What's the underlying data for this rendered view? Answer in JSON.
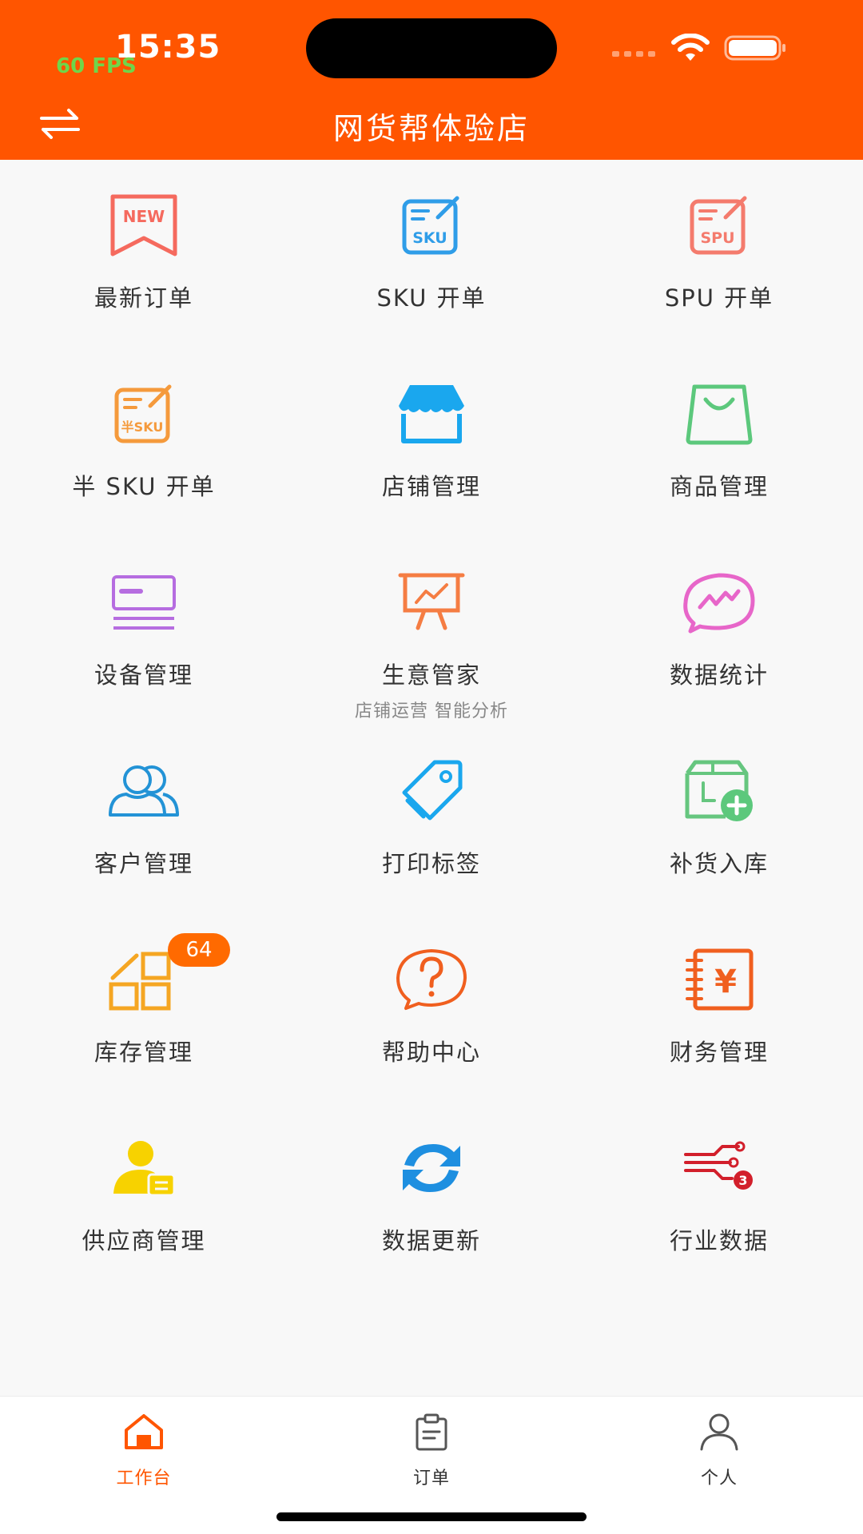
{
  "status": {
    "time": "15:35",
    "fps": "60 FPS"
  },
  "header": {
    "title": "网货帮体验店"
  },
  "grid": [
    {
      "label": "最新订单",
      "icon": "new-order-icon",
      "icon_text": "NEW"
    },
    {
      "label": "SKU 开单",
      "icon": "sku-order-icon",
      "icon_text": "SKU"
    },
    {
      "label": "SPU 开单",
      "icon": "spu-order-icon",
      "icon_text": "SPU"
    },
    {
      "label": "半 SKU 开单",
      "icon": "half-sku-order-icon",
      "icon_text": "半SKU"
    },
    {
      "label": "店铺管理",
      "icon": "store-icon"
    },
    {
      "label": "商品管理",
      "icon": "shopping-bag-icon"
    },
    {
      "label": "设备管理",
      "icon": "device-icon"
    },
    {
      "label": "生意管家",
      "icon": "business-chart-icon",
      "subtitle": "店铺运营 智能分析"
    },
    {
      "label": "数据统计",
      "icon": "statistics-icon"
    },
    {
      "label": "客户管理",
      "icon": "customers-icon"
    },
    {
      "label": "打印标签",
      "icon": "tag-icon"
    },
    {
      "label": "补货入库",
      "icon": "restock-icon"
    },
    {
      "label": "库存管理",
      "icon": "inventory-icon",
      "badge": "64"
    },
    {
      "label": "帮助中心",
      "icon": "help-icon"
    },
    {
      "label": "财务管理",
      "icon": "finance-icon",
      "icon_text": "¥"
    },
    {
      "label": "供应商管理",
      "icon": "supplier-icon"
    },
    {
      "label": "数据更新",
      "icon": "refresh-icon"
    },
    {
      "label": "行业数据",
      "icon": "industry-data-icon",
      "icon_text": "3"
    }
  ],
  "tabbar": [
    {
      "label": "工作台",
      "active": true
    },
    {
      "label": "订单",
      "active": false
    },
    {
      "label": "个人",
      "active": false
    }
  ],
  "colors": {
    "brand": "#ff5500",
    "badge": "#ff6a00",
    "fps": "#6fd64a"
  }
}
